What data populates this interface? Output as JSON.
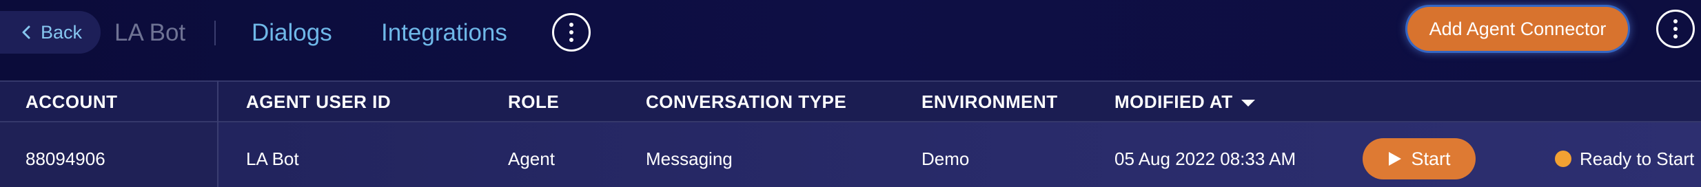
{
  "topbar": {
    "back_label": "Back",
    "bot_name": "LA Bot",
    "nav": [
      {
        "label": "Dialogs"
      },
      {
        "label": "Integrations"
      }
    ],
    "add_button_label": "Add Agent Connector"
  },
  "table": {
    "columns": [
      {
        "label": "ACCOUNT"
      },
      {
        "label": "AGENT USER ID"
      },
      {
        "label": "ROLE"
      },
      {
        "label": "CONVERSATION TYPE"
      },
      {
        "label": "ENVIRONMENT"
      },
      {
        "label": "MODIFIED AT",
        "sorted": "descending"
      }
    ],
    "rows": [
      {
        "account": "88094906",
        "agent_user_id": "LA Bot",
        "role": "Agent",
        "conversation_type": "Messaging",
        "environment": "Demo",
        "modified_at": "05 Aug 2022 08:33 AM",
        "action_label": "Start",
        "status": "Ready to Start"
      }
    ]
  },
  "colors": {
    "background": "#0c0d3a",
    "accent_orange": "#d8732e",
    "link_blue": "#6fb8e8",
    "status_dot": "#f2a133"
  },
  "icons": {
    "back": "chevron-left-icon",
    "more": "more-vertical-icon",
    "sort": "caret-down-icon",
    "play": "play-icon",
    "status": "status-dot-icon"
  }
}
